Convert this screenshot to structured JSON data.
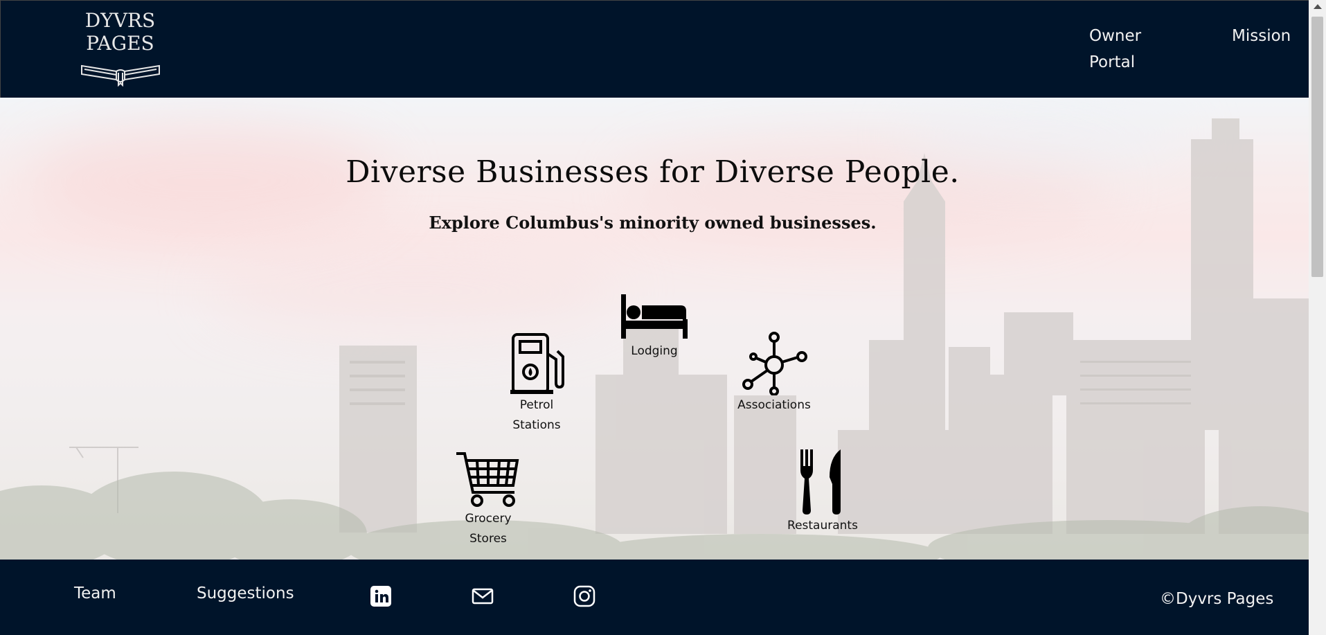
{
  "header": {
    "logo_line1": "DYVRS",
    "logo_line2": "PAGES",
    "nav": [
      {
        "label": "Owner Portal"
      },
      {
        "label": "Mission"
      }
    ]
  },
  "hero": {
    "title": "Diverse Businesses for Diverse People.",
    "subtitle": "Explore Columbus's minority owned businesses.",
    "categories": [
      {
        "label": "Lodging",
        "icon": "bed-icon"
      },
      {
        "label": "Petrol Stations",
        "icon": "fuel-pump-icon"
      },
      {
        "label": "Associations",
        "icon": "network-icon"
      },
      {
        "label": "Grocery Stores",
        "icon": "shopping-cart-icon"
      },
      {
        "label": "Restaurants",
        "icon": "fork-knife-icon"
      }
    ]
  },
  "footer": {
    "team": "Team",
    "suggestions": "Suggestions",
    "social": [
      {
        "icon": "linkedin-icon"
      },
      {
        "icon": "mail-icon"
      },
      {
        "icon": "instagram-icon"
      }
    ],
    "copyright": "©Dyvrs Pages"
  },
  "colors": {
    "navy": "#00142a",
    "nav_text": "#f2f2f2",
    "hero_text": "#0c0c0c"
  }
}
